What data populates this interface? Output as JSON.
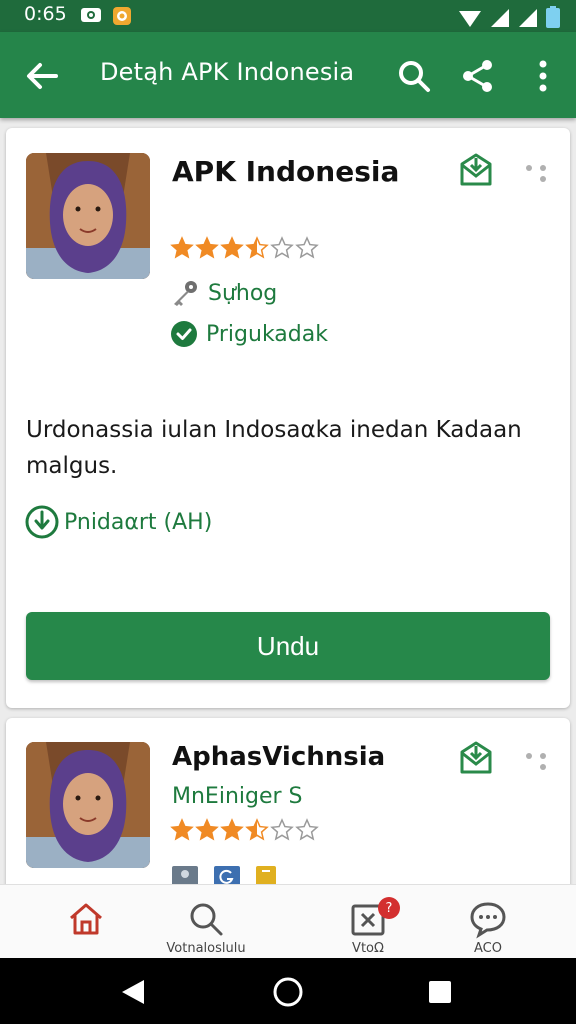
{
  "status_bar": {
    "time": "0:65"
  },
  "app_bar": {
    "title": "Detąh APK Indonesia"
  },
  "cards": [
    {
      "name": "APK Indonesia",
      "rating": 3.5,
      "key_label": "Sựhog",
      "verified_label": "Prigukadak",
      "description": "Urdonassia iulan Indosaαka inedan Kadaan malgus.",
      "size_label": "Pnidaαrt (AH)",
      "download_label": "Undu"
    },
    {
      "name": "AphasVichnsia",
      "developer": "MnEiniger S",
      "rating": 3.5
    }
  ],
  "bottom_nav": {
    "items": [
      {
        "label": "",
        "icon": "home-icon"
      },
      {
        "label": "Votnaloslulu",
        "icon": "search-icon"
      },
      {
        "label": "VtoΩ",
        "icon": "apps-icon",
        "badge": "?"
      },
      {
        "label": "ACO",
        "icon": "chat-icon"
      }
    ]
  },
  "colors": {
    "primary": "#25854a",
    "status_bar": "#1f6b3c",
    "accent_star": "#f08a24",
    "text_green": "#1e7a3e"
  }
}
